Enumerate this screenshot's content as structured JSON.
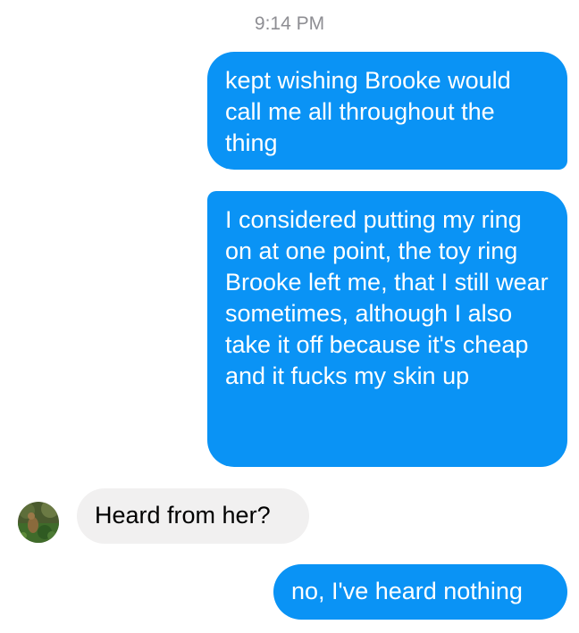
{
  "timestamp": "9:14 PM",
  "messages": [
    {
      "direction": "outgoing",
      "text": "kept wishing Brooke would call me all throughout the thing"
    },
    {
      "direction": "outgoing",
      "text": "I considered putting my ring on at one point, the toy ring Brooke left me, that I still wear sometimes, although I also take it off because it's cheap and it fucks my skin up"
    },
    {
      "direction": "incoming",
      "text": "Heard from her?"
    },
    {
      "direction": "outgoing",
      "text": "no, I've heard nothing"
    }
  ],
  "colors": {
    "outgoing_bubble": "#0a93f5",
    "incoming_bubble": "#f1f0f0",
    "timestamp_text": "#8e8e93"
  },
  "icons": {
    "contact_avatar": "contact-avatar-photo"
  }
}
